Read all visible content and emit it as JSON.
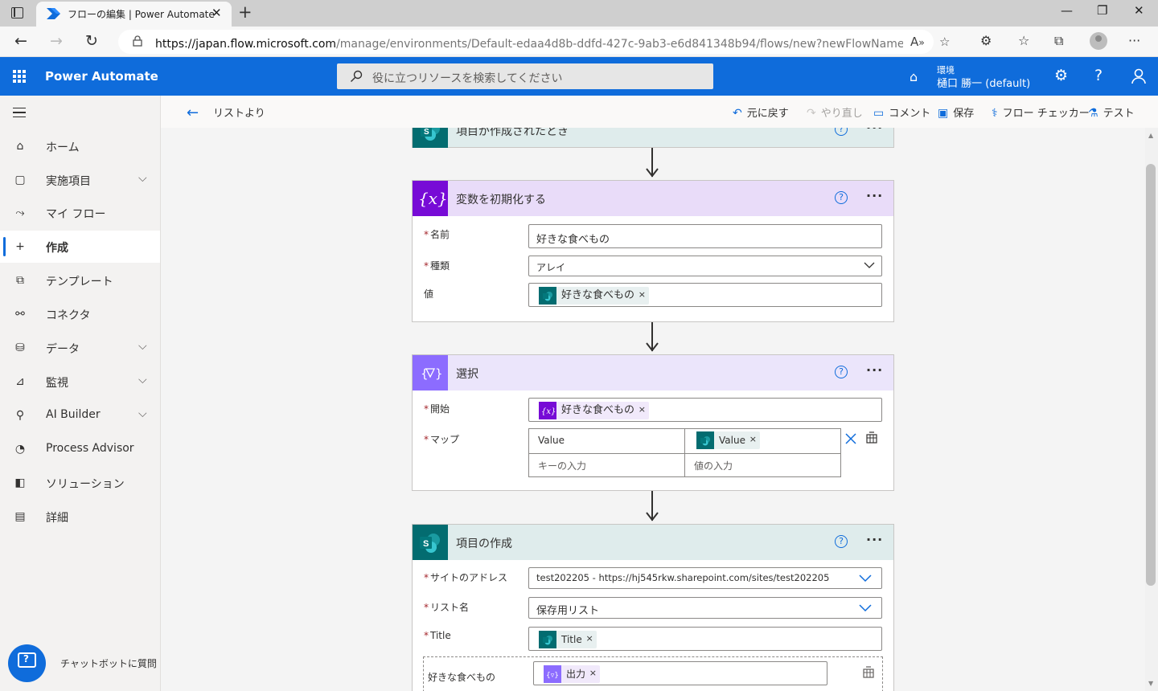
{
  "browser": {
    "tab_title": "フローの編集 | Power Automate",
    "url_host": "https://japan.flow.microsoft.com",
    "url_path": "/manage/environments/Default-edaa4d8b-ddfd-427c-9ab3-e6d841348b94/flows/new?newFlowName=リストより&tri...",
    "read_aloud_icon": "read-aloud-icon"
  },
  "header": {
    "app_name": "Power Automate",
    "search_placeholder": "役に立つリソースを検索してください",
    "env_label": "環境",
    "env_name": "樋口 勝一 (default)",
    "brand_color": "#0f6cdb"
  },
  "nav": {
    "items": [
      {
        "label": "ホーム",
        "icon": "home-icon",
        "glyph": "⌂"
      },
      {
        "label": "実施項目",
        "icon": "clipboard-icon",
        "glyph": "▢",
        "chevron": "⌵"
      },
      {
        "label": "マイ フロー",
        "icon": "flow-icon",
        "glyph": "⤳"
      },
      {
        "label": "作成",
        "icon": "plus-icon",
        "glyph": "+"
      },
      {
        "label": "テンプレート",
        "icon": "template-icon",
        "glyph": "⧉"
      },
      {
        "label": "コネクタ",
        "icon": "connector-icon",
        "glyph": "⚯"
      },
      {
        "label": "データ",
        "icon": "database-icon",
        "glyph": "⛁",
        "chevron": "⌵"
      },
      {
        "label": "監視",
        "icon": "monitor-icon",
        "glyph": "⊿",
        "chevron": "⌵"
      },
      {
        "label": "AI Builder",
        "icon": "ai-builder-icon",
        "glyph": "⚲",
        "chevron": "⌵"
      },
      {
        "label": "Process Advisor",
        "icon": "process-advisor-icon",
        "glyph": "◔"
      },
      {
        "label": "ソリューション",
        "icon": "solution-icon",
        "glyph": "◧"
      },
      {
        "label": "詳細",
        "icon": "book-icon",
        "glyph": "▤"
      }
    ],
    "chatbot_label": "チャットボットに質問"
  },
  "cmdbar": {
    "back_label": "リストより",
    "undo_label": "元に戻す",
    "redo_label": "やり直し",
    "comment_label": "コメント",
    "save_label": "保存",
    "checker_label": "フロー チェッカー",
    "test_label": "テスト"
  },
  "cards": {
    "trigger": {
      "title": "項目が作成されたとき"
    },
    "init_var": {
      "title": "変数を初期化する",
      "name_label": "名前",
      "name_value": "好きな食べもの",
      "type_label": "種類",
      "type_value": "アレイ",
      "value_label": "値",
      "value_token": "好きな食べもの",
      "color": "#770bd6"
    },
    "select": {
      "title": "選択",
      "from_label": "開始",
      "from_token": "好きな食べもの",
      "map_label": "マップ",
      "map_key": "Value",
      "map_value_token": "Value",
      "key_placeholder": "キーの入力",
      "value_placeholder": "値の入力",
      "color": "#8c6cff"
    },
    "create_item": {
      "title": "項目の作成",
      "site_label": "サイトのアドレス",
      "site_value": "test202205 - https://hj545rkw.sharepoint.com/sites/test202205",
      "list_label": "リスト名",
      "list_value": "保存用リスト",
      "title_label": "Title",
      "title_token": "Title",
      "food_label": "好きな食べもの",
      "food_token": "出力",
      "color": "#036c70"
    }
  },
  "help_glyph": "?",
  "more_glyph": "···",
  "close_glyph": "×"
}
